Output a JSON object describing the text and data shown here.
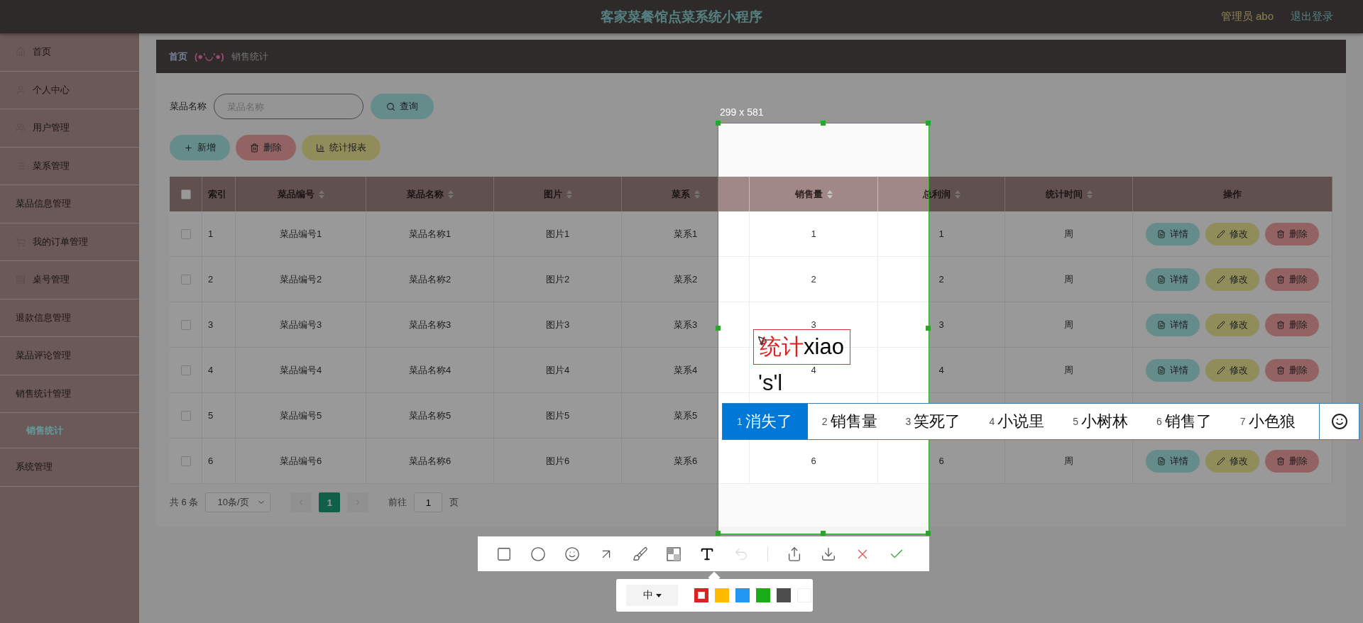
{
  "header": {
    "title": "客家菜餐馆点菜系统小程序",
    "user": "管理员 abo",
    "logout": "退出登录"
  },
  "sidebar": {
    "items": [
      {
        "label": "首页",
        "selected": false
      },
      {
        "label": "个人中心",
        "selected": false
      },
      {
        "label": "用户管理",
        "selected": false
      },
      {
        "label": "菜系管理",
        "selected": false
      },
      {
        "label": "菜品信息管理",
        "selected": false
      },
      {
        "label": "我的订单管理",
        "selected": false
      },
      {
        "label": "桌号管理",
        "selected": false
      },
      {
        "label": "退款信息管理",
        "selected": false
      },
      {
        "label": "菜品评论管理",
        "selected": false
      },
      {
        "label": "销售统计管理",
        "selected": false,
        "children": [
          {
            "label": "销售统计",
            "selected": true
          }
        ]
      },
      {
        "label": "系统管理",
        "selected": false
      }
    ]
  },
  "breadcrumb": {
    "home": "首页",
    "separator": "(●'◡'●)",
    "current": "销售统计"
  },
  "search": {
    "label": "菜品名称",
    "placeholder": "菜品名称",
    "button": "查询"
  },
  "actions": [
    {
      "label": "新增",
      "kind": "add"
    },
    {
      "label": "删除",
      "kind": "delete"
    },
    {
      "label": "统计报表",
      "kind": "report"
    }
  ],
  "table": {
    "select_all": {
      "checked": false
    },
    "columns": [
      {
        "label": "索引",
        "sortable": false
      },
      {
        "label": "菜品编号",
        "sortable": true
      },
      {
        "label": "菜品名称",
        "sortable": true
      },
      {
        "label": "图片",
        "sortable": true
      },
      {
        "label": "菜系",
        "sortable": true
      },
      {
        "label": "销售量",
        "sortable": true
      },
      {
        "label": "总利润",
        "sortable": true
      },
      {
        "label": "统计时间",
        "sortable": true
      },
      {
        "label": "操作",
        "sortable": false
      }
    ],
    "rows": [
      {
        "checked": false,
        "cells": [
          "1",
          "菜品编号1",
          "菜品名称1",
          "图片1",
          "菜系1",
          "1",
          "1",
          "周"
        ],
        "actions": [
          {
            "label": "详情",
            "kind": "detail"
          },
          {
            "label": "修改",
            "kind": "edit"
          },
          {
            "label": "删除",
            "kind": "delete"
          }
        ]
      },
      {
        "checked": false,
        "cells": [
          "2",
          "菜品编号2",
          "菜品名称2",
          "图片2",
          "菜系2",
          "2",
          "2",
          "周"
        ],
        "actions": [
          {
            "label": "详情",
            "kind": "detail"
          },
          {
            "label": "修改",
            "kind": "edit"
          },
          {
            "label": "删除",
            "kind": "delete"
          }
        ]
      },
      {
        "checked": false,
        "cells": [
          "3",
          "菜品编号3",
          "菜品名称3",
          "图片3",
          "菜系3",
          "3",
          "3",
          "周"
        ],
        "actions": [
          {
            "label": "详情",
            "kind": "detail"
          },
          {
            "label": "修改",
            "kind": "edit"
          },
          {
            "label": "删除",
            "kind": "delete"
          }
        ]
      },
      {
        "checked": false,
        "cells": [
          "4",
          "菜品编号4",
          "菜品名称4",
          "图片4",
          "菜系4",
          "4",
          "4",
          "周"
        ],
        "actions": [
          {
            "label": "详情",
            "kind": "detail"
          },
          {
            "label": "修改",
            "kind": "edit"
          },
          {
            "label": "删除",
            "kind": "delete"
          }
        ]
      },
      {
        "checked": false,
        "cells": [
          "5",
          "菜品编号5",
          "菜品名称5",
          "图片5",
          "菜系5"
        ]
      },
      {
        "checked": false,
        "cells": [
          "6",
          "菜品编号6",
          "菜品名称6",
          "图片6",
          "菜系6",
          "6",
          "6",
          "周"
        ],
        "actions": [
          {
            "label": "详情",
            "kind": "detail"
          },
          {
            "label": "修改",
            "kind": "edit"
          },
          {
            "label": "删除",
            "kind": "delete"
          }
        ]
      }
    ]
  },
  "pagination": {
    "total": "共 6 条",
    "page_size": "10条/页",
    "pages": [
      {
        "label": "1",
        "selected": true
      }
    ],
    "goto_label": "前往",
    "goto_value": "1",
    "goto_suffix": "页"
  },
  "capture": {
    "size": "299 x 581",
    "tools": [
      {
        "kind": "rect",
        "selected": false,
        "disabled": false
      },
      {
        "kind": "ellipse",
        "selected": false,
        "disabled": false
      },
      {
        "kind": "emoji",
        "selected": false,
        "disabled": false
      },
      {
        "kind": "arrow",
        "selected": false,
        "disabled": false
      },
      {
        "kind": "brush",
        "selected": false,
        "disabled": false
      },
      {
        "kind": "mosaic",
        "selected": false,
        "disabled": false
      },
      {
        "kind": "text",
        "selected": true,
        "disabled": false
      },
      {
        "kind": "undo",
        "selected": false,
        "disabled": true
      },
      {
        "kind": "share",
        "selected": false,
        "disabled": false
      },
      {
        "kind": "save",
        "selected": false,
        "disabled": false
      },
      {
        "kind": "cancel",
        "selected": false,
        "disabled": false
      },
      {
        "kind": "confirm",
        "selected": false,
        "disabled": false
      }
    ],
    "font_size": "中",
    "colors": [
      {
        "color": "#e02020",
        "selected": true
      },
      {
        "color": "#ffbb00",
        "selected": false
      },
      {
        "color": "#2196f3",
        "selected": false
      },
      {
        "color": "#1aad19",
        "selected": false
      },
      {
        "color": "#4d4d4d",
        "selected": false
      },
      {
        "color": "#ffffff",
        "selected": false
      }
    ],
    "annotation": {
      "committed": "统计",
      "typing": "xiao"
    },
    "composition": "'s'l"
  },
  "ime": {
    "candidates": [
      {
        "index": "1",
        "text": "消失了",
        "selected": true
      },
      {
        "index": "2",
        "text": "销售量",
        "selected": false
      },
      {
        "index": "3",
        "text": "笑死了",
        "selected": false
      },
      {
        "index": "4",
        "text": "小说里",
        "selected": false
      },
      {
        "index": "5",
        "text": "小树林",
        "selected": false
      },
      {
        "index": "6",
        "text": "销售了",
        "selected": false
      },
      {
        "index": "7",
        "text": "小色狼",
        "selected": false
      }
    ]
  }
}
